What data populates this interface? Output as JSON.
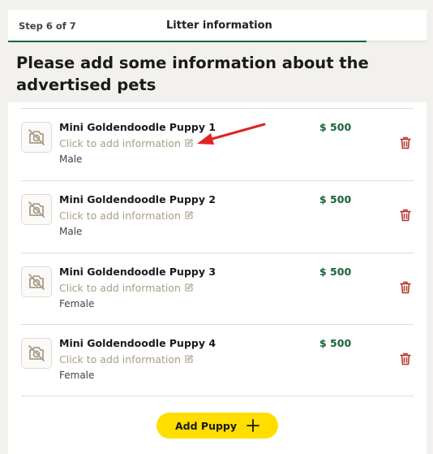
{
  "header": {
    "step_label": "Step 6 of 7",
    "title": "Litter information",
    "progress_fraction": 0.857
  },
  "page_title": "Please add some information about the advertised pets",
  "puppies": [
    {
      "name": "Mini Goldendoodle Puppy 1",
      "info_link": "Click to add information",
      "gender": "Male",
      "price": "$ 500"
    },
    {
      "name": "Mini Goldendoodle Puppy 2",
      "info_link": "Click to add information",
      "gender": "Male",
      "price": "$ 500"
    },
    {
      "name": "Mini Goldendoodle Puppy 3",
      "info_link": "Click to add information",
      "gender": "Female",
      "price": "$ 500"
    },
    {
      "name": "Mini Goldendoodle Puppy 4",
      "info_link": "Click to add information",
      "gender": "Female",
      "price": "$ 500"
    }
  ],
  "add_button": {
    "label": "Add Puppy"
  },
  "icons": {
    "thumbnail": "no-photo-icon",
    "edit": "pencil-square-icon",
    "delete": "trash-icon",
    "add": "plus-icon",
    "annotation": "red-arrow-icon"
  },
  "colors": {
    "accent_green": "#17643b",
    "button_yellow": "#ffde00",
    "delete_red": "#b3322a",
    "muted_text": "#a89e87",
    "annotation_red": "#e02424"
  }
}
